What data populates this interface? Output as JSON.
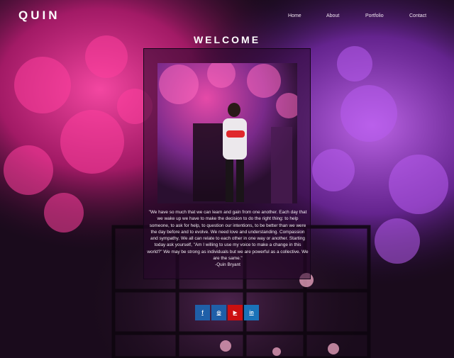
{
  "brand": {
    "name": "QUIN"
  },
  "nav": {
    "items": [
      "Home",
      "About",
      "Portfolio",
      "Contact"
    ]
  },
  "hero": {
    "title": "WELCOME",
    "quote": "\"We have so much that we can learn and gain from one another. Each day that we wake up we have to make the decision to do the right thing: to help someone, to ask for help, to question our intentions, to be better than we were the day before and to evolve. We need love and understanding. Compassion and sympathy. We all can relate to each other in one way or another. Starting today ask yourself, \"Am I willing to use my voice to make a change in this world?\" We may be strong as individuals but we are powerful as a collective. We are the same.\"",
    "author": "-Quin Bryant"
  },
  "social": {
    "buttons": [
      {
        "icon": "facebook-icon",
        "glyph": "f",
        "color": "#1f5fa8"
      },
      {
        "icon": "instagram-icon",
        "glyph": "◎",
        "color": "#1f5fa8"
      },
      {
        "icon": "youtube-icon",
        "glyph": "▶",
        "color": "#cc1010"
      },
      {
        "icon": "linkedin-icon",
        "glyph": "in",
        "color": "#1a73b8"
      }
    ]
  },
  "colors": {
    "blossom_pink": "#e0308c",
    "blossom_purple": "#a040d8",
    "panel_border": "#15051a"
  }
}
